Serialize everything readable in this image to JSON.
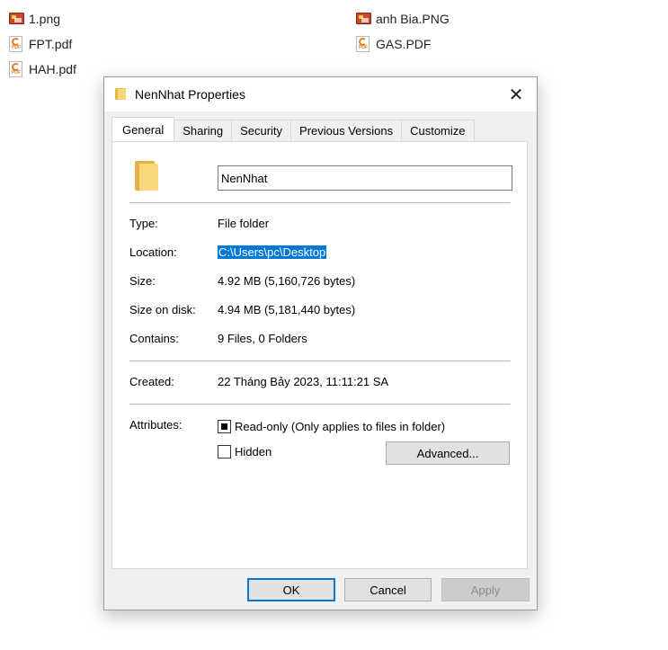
{
  "desktop": {
    "files": [
      {
        "name": "1.png",
        "type": "image"
      },
      {
        "name": "FPT.pdf",
        "type": "pdf"
      },
      {
        "name": "HAH.pdf",
        "type": "pdf"
      },
      {
        "name": "anh Bia.PNG",
        "type": "image"
      },
      {
        "name": "GAS.PDF",
        "type": "pdf"
      }
    ]
  },
  "dialog": {
    "title": "NenNhat Properties",
    "close_label": "✕",
    "tabs": [
      "General",
      "Sharing",
      "Security",
      "Previous Versions",
      "Customize"
    ],
    "active_tab": "General",
    "folder_name": "NenNhat",
    "fields": {
      "type_label": "Type:",
      "type_value": "File folder",
      "location_label": "Location:",
      "location_value": "C:\\Users\\pc\\Desktop",
      "size_label": "Size:",
      "size_value": "4.92 MB (5,160,726 bytes)",
      "size_on_disk_label": "Size on disk:",
      "size_on_disk_value": "4.94 MB (5,181,440 bytes)",
      "contains_label": "Contains:",
      "contains_value": "9 Files, 0 Folders",
      "created_label": "Created:",
      "created_value": "22 Tháng Bảy 2023, 11:11:21 SA",
      "attributes_label": "Attributes:"
    },
    "attributes": {
      "readonly_label": "Read-only (Only applies to files in folder)",
      "readonly_state": "indeterminate",
      "hidden_label": "Hidden",
      "hidden_state": "unchecked",
      "advanced_label": "Advanced..."
    },
    "buttons": {
      "ok": "OK",
      "cancel": "Cancel",
      "apply": "Apply"
    }
  },
  "colors": {
    "selection": "#0078d7",
    "dialog_bg": "#f0f0f0",
    "folder_yellow": "#f9d97a"
  }
}
